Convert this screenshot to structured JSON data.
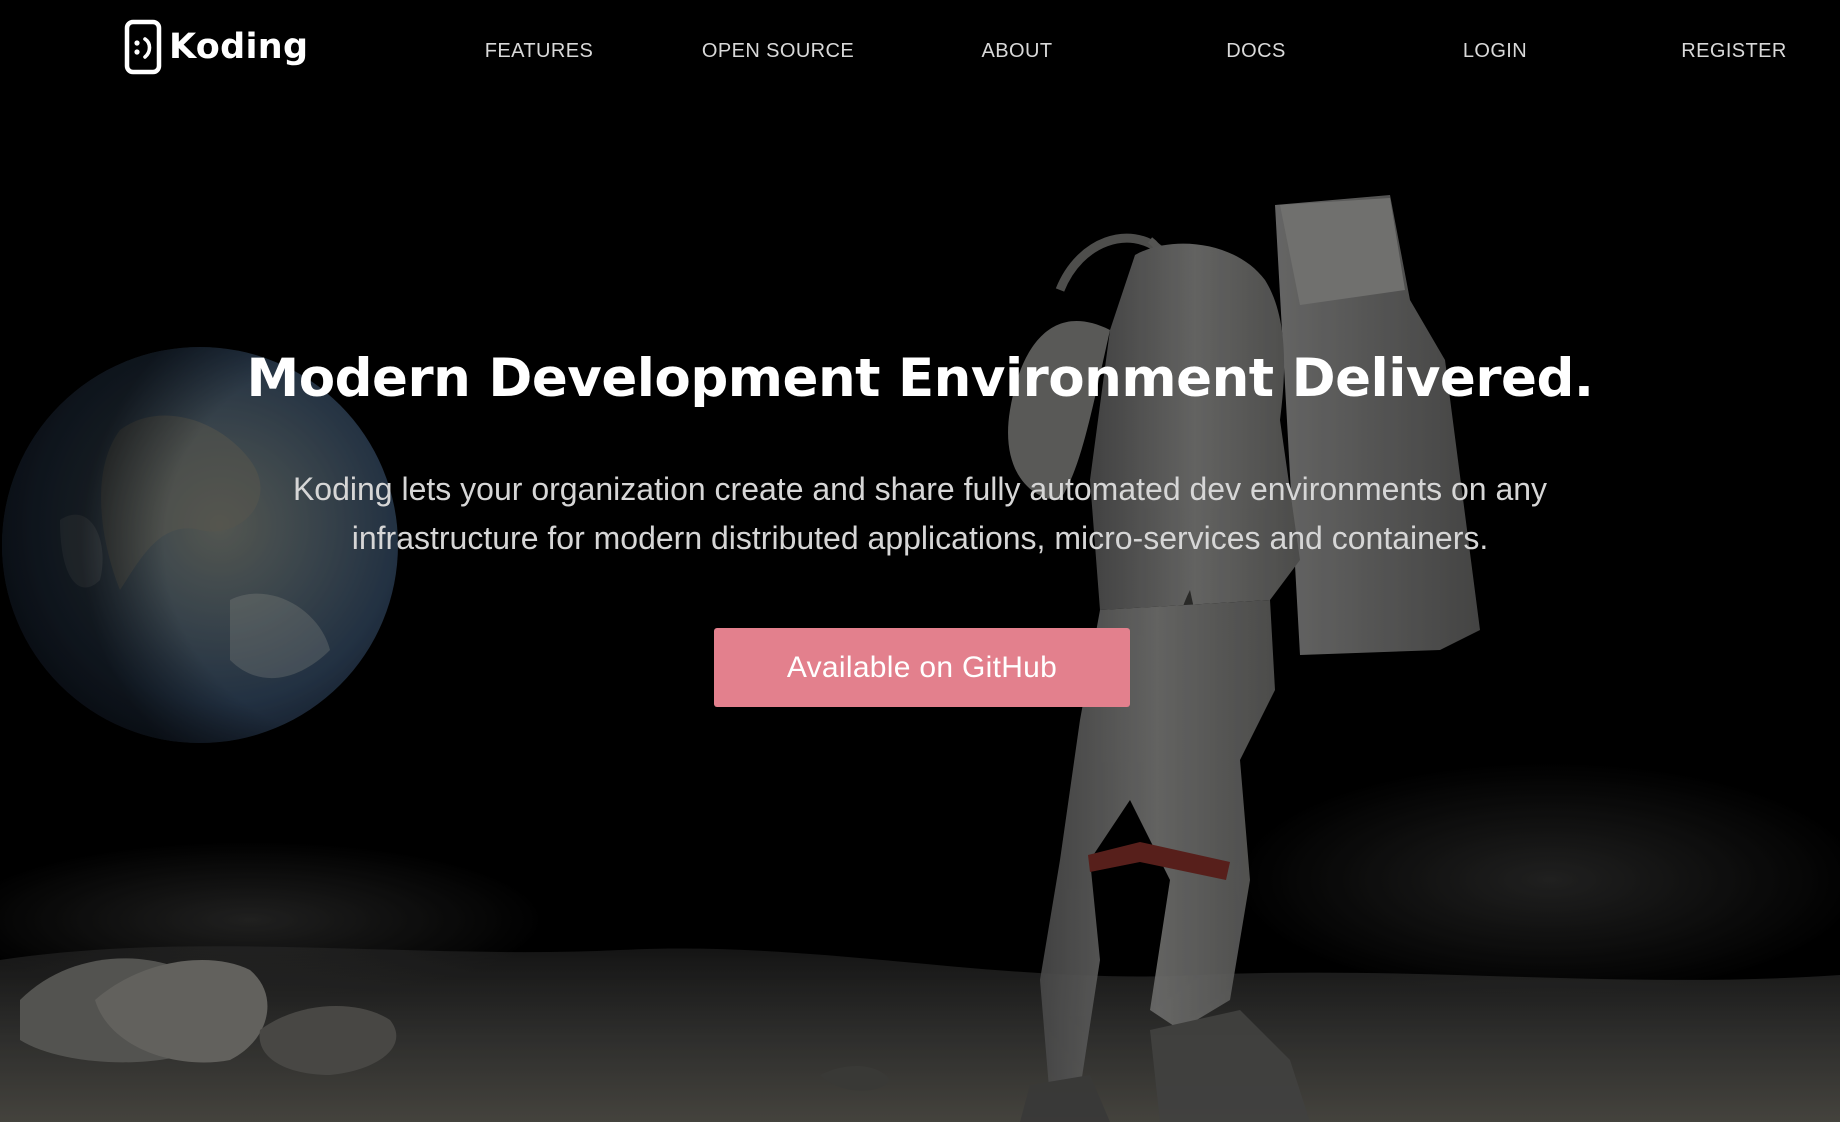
{
  "brand": {
    "name": "Koding",
    "logo_icon": "koding-face-icon"
  },
  "nav": {
    "items": [
      {
        "label": "FEATURES"
      },
      {
        "label": "OPEN SOURCE"
      },
      {
        "label": "ABOUT"
      },
      {
        "label": "DOCS"
      },
      {
        "label": "LOGIN"
      },
      {
        "label": "REGISTER"
      }
    ]
  },
  "hero": {
    "headline": "Modern Development Environment Delivered.",
    "subheadline": "Koding lets your organization create and share fully automated dev environments on any infrastructure for modern distributed applications, micro-services and containers.",
    "cta_label": "Available on GitHub",
    "background_image": "astronaut-on-moon-with-earth"
  },
  "colors": {
    "background": "#000000",
    "cta": "#e3808d",
    "text": "#ffffff",
    "nav_text": "#d9d9d9",
    "subhead_text": "#d6d6d6"
  }
}
